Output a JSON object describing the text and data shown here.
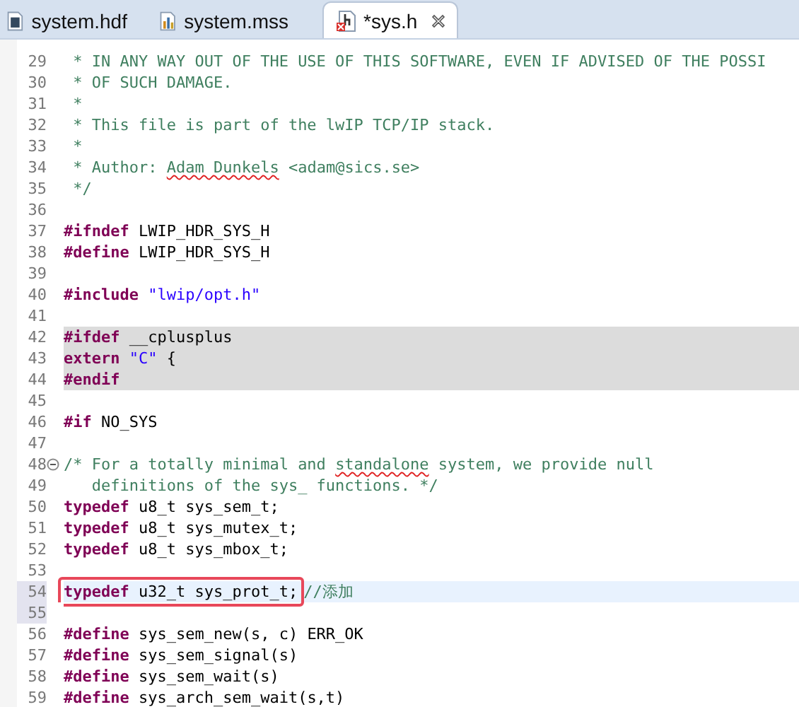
{
  "tabs": [
    {
      "label": "system.hdf",
      "kind": "hdf",
      "selected": false
    },
    {
      "label": "system.mss",
      "kind": "mss",
      "selected": false
    },
    {
      "label": "*sys.h",
      "kind": "header",
      "selected": true
    }
  ],
  "lines": [
    {
      "number": "29",
      "kind": "normal",
      "gutter_selected": false,
      "code": [
        {
          "kind": "comment",
          "text": " * IN ANY WAY OUT OF THE USE OF THIS SOFTWARE, EVEN IF ADVISED OF THE POSSI"
        }
      ]
    },
    {
      "number": "30",
      "kind": "normal",
      "gutter_selected": false,
      "code": [
        {
          "kind": "comment",
          "text": " * OF SUCH DAMAGE."
        }
      ]
    },
    {
      "number": "31",
      "kind": "normal",
      "gutter_selected": false,
      "code": [
        {
          "kind": "comment",
          "text": " *"
        }
      ]
    },
    {
      "number": "32",
      "kind": "normal",
      "gutter_selected": false,
      "code": [
        {
          "kind": "comment",
          "text": " * This file is part of the lwIP TCP/IP stack."
        }
      ]
    },
    {
      "number": "33",
      "kind": "normal",
      "gutter_selected": false,
      "code": [
        {
          "kind": "comment",
          "text": " *"
        }
      ]
    },
    {
      "number": "34",
      "kind": "normal",
      "gutter_selected": false,
      "code": [
        {
          "kind": "comment",
          "text": " * Author: "
        },
        {
          "kind": "misspelled",
          "text": "Adam Dunkels"
        },
        {
          "kind": "comment",
          "text": " <adam@sics.se>"
        }
      ]
    },
    {
      "number": "35",
      "kind": "normal",
      "gutter_selected": false,
      "code": [
        {
          "kind": "comment",
          "text": " */"
        }
      ]
    },
    {
      "number": "36",
      "kind": "normal",
      "gutter_selected": false
    },
    {
      "number": "37",
      "kind": "normal",
      "gutter_selected": false,
      "code": [
        {
          "kind": "directive",
          "text": "#ifndef"
        },
        {
          "kind": "plain",
          "text": " LWIP_HDR_SYS_H"
        }
      ]
    },
    {
      "number": "38",
      "kind": "normal",
      "gutter_selected": false,
      "code": [
        {
          "kind": "directive",
          "text": "#define"
        },
        {
          "kind": "plain",
          "text": " LWIP_HDR_SYS_H"
        }
      ]
    },
    {
      "number": "39",
      "kind": "normal",
      "gutter_selected": false
    },
    {
      "number": "40",
      "kind": "normal",
      "gutter_selected": false,
      "code": [
        {
          "kind": "directive",
          "text": "#include "
        },
        {
          "kind": "string",
          "text": "\"lwip/opt.h\""
        }
      ]
    },
    {
      "number": "41",
      "kind": "normal",
      "gutter_selected": false
    },
    {
      "number": "42",
      "kind": "inactive",
      "gutter_selected": false,
      "code": [
        {
          "kind": "directive",
          "text": "#ifdef"
        },
        {
          "kind": "plain",
          "text": " __cplusplus"
        }
      ]
    },
    {
      "number": "43",
      "kind": "inactive",
      "gutter_selected": false,
      "code": [
        {
          "kind": "keyword",
          "text": "extern "
        },
        {
          "kind": "string",
          "text": "\"C\""
        },
        {
          "kind": "plain",
          "text": " {"
        }
      ]
    },
    {
      "number": "44",
      "kind": "inactive",
      "gutter_selected": false,
      "code": [
        {
          "kind": "directive",
          "text": "#endif"
        }
      ]
    },
    {
      "number": "45",
      "kind": "normal",
      "gutter_selected": false
    },
    {
      "number": "46",
      "kind": "normal",
      "gutter_selected": false,
      "code": [
        {
          "kind": "directive",
          "text": "#if"
        },
        {
          "kind": "plain",
          "text": " NO_SYS"
        }
      ]
    },
    {
      "number": "47",
      "kind": "normal",
      "gutter_selected": false
    },
    {
      "number": "48",
      "kind": "normal",
      "gutter_selected": false,
      "fold": true,
      "code": [
        {
          "kind": "comment",
          "text": "/* For a totally minimal and "
        },
        {
          "kind": "misspelled",
          "text": "standalone"
        },
        {
          "kind": "comment",
          "text": " system, we provide null"
        }
      ]
    },
    {
      "number": "49",
      "kind": "normal",
      "gutter_selected": false,
      "code": [
        {
          "kind": "comment",
          "text": "   definitions of the sys_ functions. */"
        }
      ]
    },
    {
      "number": "50",
      "kind": "normal",
      "gutter_selected": false,
      "code": [
        {
          "kind": "keyword",
          "text": "typedef"
        },
        {
          "kind": "plain",
          "text": " u8_t sys_sem_t;"
        }
      ]
    },
    {
      "number": "51",
      "kind": "normal",
      "gutter_selected": false,
      "code": [
        {
          "kind": "keyword",
          "text": "typedef"
        },
        {
          "kind": "plain",
          "text": " u8_t sys_mutex_t;"
        }
      ]
    },
    {
      "number": "52",
      "kind": "normal",
      "gutter_selected": false,
      "code": [
        {
          "kind": "keyword",
          "text": "typedef"
        },
        {
          "kind": "plain",
          "text": " u8_t sys_mbox_t;"
        }
      ]
    },
    {
      "number": "53",
      "kind": "normal",
      "gutter_selected": false
    },
    {
      "number": "54",
      "kind": "current",
      "gutter_selected": true,
      "boxed": [
        {
          "kind": "keyword",
          "text": "typedef"
        },
        {
          "kind": "plain",
          "text": " u32_t sys_prot_t;"
        }
      ],
      "code": [
        {
          "kind": "comment",
          "text": "//添加"
        }
      ]
    },
    {
      "number": "55",
      "kind": "normal",
      "gutter_selected": true
    },
    {
      "number": "56",
      "kind": "normal",
      "gutter_selected": false,
      "code": [
        {
          "kind": "directive",
          "text": "#define"
        },
        {
          "kind": "plain",
          "text": " sys_sem_new(s, c) ERR_OK"
        }
      ]
    },
    {
      "number": "57",
      "kind": "normal",
      "gutter_selected": false,
      "code": [
        {
          "kind": "directive",
          "text": "#define"
        },
        {
          "kind": "plain",
          "text": " sys_sem_signal(s)"
        }
      ]
    },
    {
      "number": "58",
      "kind": "normal",
      "gutter_selected": false,
      "code": [
        {
          "kind": "directive",
          "text": "#define"
        },
        {
          "kind": "plain",
          "text": " sys_sem_wait(s)"
        }
      ]
    },
    {
      "number": "59",
      "kind": "normal",
      "gutter_selected": false,
      "code": [
        {
          "kind": "directive",
          "text": "#define"
        },
        {
          "kind": "plain",
          "text": " sys_arch_sem_wait(s,t)"
        }
      ]
    }
  ]
}
